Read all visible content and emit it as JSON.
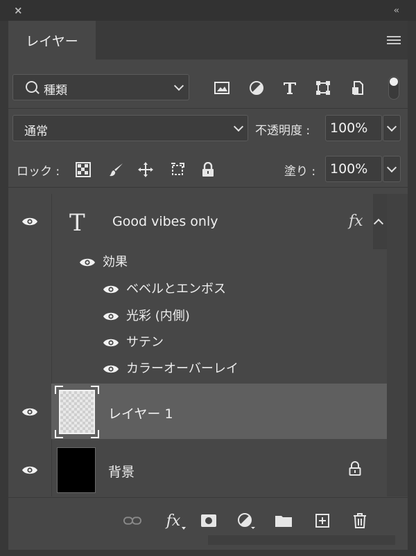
{
  "window": {
    "close_glyph": "×",
    "collapse_glyph": "‹‹"
  },
  "tab": {
    "label": "レイヤー"
  },
  "filter": {
    "kind_label": "種類"
  },
  "blend": {
    "mode": "通常",
    "opacity_label": "不透明度 :",
    "opacity_value": "100%"
  },
  "lock": {
    "label": "ロック :",
    "fill_label": "塗り :",
    "fill_value": "100%"
  },
  "layers": {
    "text_layer": {
      "name": "Good vibes only",
      "type_glyph": "T",
      "fx_label": "fx"
    },
    "effects_label": "効果",
    "effects": [
      "ベベルとエンボス",
      "光彩 (内側)",
      "サテン",
      "カラーオーバーレイ"
    ],
    "layer1": {
      "name": "レイヤー 1"
    },
    "background": {
      "name": "背景"
    }
  },
  "footer": {
    "fx_label": "fx"
  },
  "colors": {
    "panel": "#474747",
    "selected_row": "#5f5f5f",
    "text": "#f0f0f0"
  }
}
